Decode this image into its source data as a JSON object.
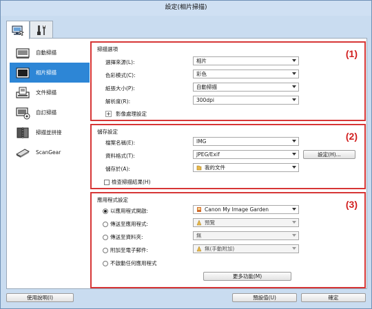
{
  "window": {
    "title": "設定(相片掃描)"
  },
  "tabs": [
    {
      "icon": "scan-settings-icon"
    },
    {
      "icon": "tools-icon"
    }
  ],
  "sidebar": {
    "items": [
      {
        "label": "自動掃描",
        "icon": "auto-scan-icon"
      },
      {
        "label": "相片掃描",
        "icon": "photo-scan-icon",
        "active": true
      },
      {
        "label": "文件掃描",
        "icon": "document-scan-icon"
      },
      {
        "label": "自訂掃描",
        "icon": "custom-scan-icon"
      },
      {
        "label": "掃描並拼接",
        "icon": "scan-stitch-icon"
      },
      {
        "label": "ScanGear",
        "icon": "scangear-icon"
      }
    ]
  },
  "scan_options": {
    "title": "掃描選項",
    "number": "(1)",
    "rows": [
      {
        "label": "選擇來源(L):",
        "value": "相片"
      },
      {
        "label": "色彩模式(C):",
        "value": "彩色"
      },
      {
        "label": "紙張大小(P):",
        "value": "自動掃描"
      },
      {
        "label": "解析度(R):",
        "value": "300dpi"
      }
    ],
    "image_processing": "影像處理設定"
  },
  "save_settings": {
    "title": "儲存設定",
    "number": "(2)",
    "file_name_label": "檔案名稱(E):",
    "file_name_value": "IMG",
    "data_format_label": "資料格式(T):",
    "data_format_value": "JPEG/Exif",
    "settings_button": "設定(H)...",
    "save_in_label": "儲存於(A):",
    "save_in_value": "我的文件",
    "check_scan_label": "檢查掃描結果(H)"
  },
  "app_settings": {
    "title": "應用程式設定",
    "number": "(3)",
    "options": [
      {
        "label": "以應用程式開啟:",
        "value": "Canon My Image Garden",
        "checked": true,
        "enabled": true
      },
      {
        "label": "傳送至應用程式:",
        "value": "預覽",
        "checked": false,
        "enabled": false
      },
      {
        "label": "傳送至資料夾:",
        "value": "無",
        "checked": false,
        "enabled": false
      },
      {
        "label": "附加至電子郵件:",
        "value": "無(手動附加)",
        "checked": false,
        "enabled": false
      },
      {
        "label": "不啟動任何應用程式",
        "value": "",
        "checked": false,
        "enabled": false
      }
    ],
    "more_functions": "更多功能(M)"
  },
  "footer": {
    "instructions": "使用說明(I)",
    "defaults": "預設值(U)",
    "ok": "確定"
  }
}
